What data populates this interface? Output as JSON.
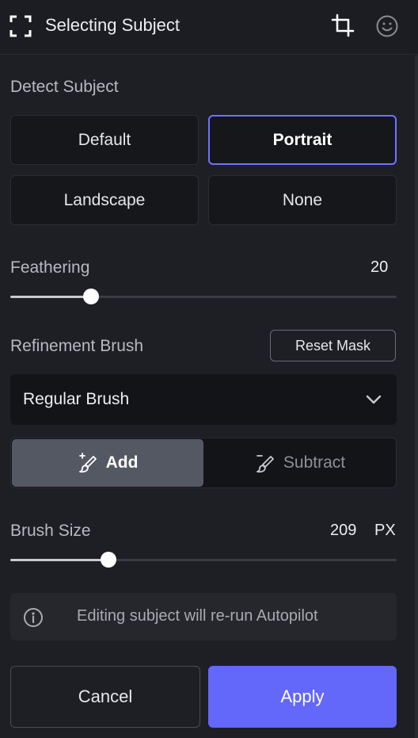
{
  "header": {
    "title": "Selecting Subject",
    "icons": [
      "select-subject-icon",
      "crop-icon",
      "smiley-face-icon"
    ]
  },
  "detect_subject": {
    "label": "Detect Subject",
    "options": [
      "Default",
      "Portrait",
      "Landscape",
      "None"
    ],
    "selected": "Portrait"
  },
  "feathering": {
    "label": "Feathering",
    "value": "20",
    "level": 0.21
  },
  "refinement": {
    "label": "Refinement Brush",
    "reset_label": "Reset Mask",
    "brush_type": "Regular Brush",
    "add_label": "Add",
    "subtract_label": "Subtract",
    "mode": "Add"
  },
  "brush_size": {
    "label": "Brush Size",
    "value": "209",
    "unit": "PX",
    "level": 0.255
  },
  "info": {
    "text": "Editing subject will re-run Autopilot"
  },
  "actions": {
    "cancel_label": "Cancel",
    "apply_label": "Apply"
  },
  "colors": {
    "accent": "#6367fa",
    "selected_border": "#6e73ff",
    "background": "#1e1f25"
  }
}
